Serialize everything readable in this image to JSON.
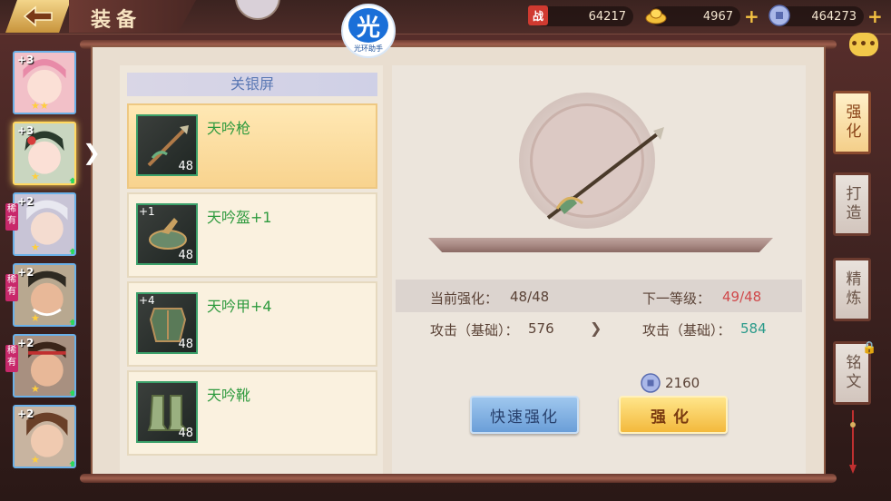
{
  "header": {
    "title": "装备",
    "assistant_badge": "光",
    "assistant_label": "光环助手"
  },
  "resources": [
    {
      "icon": "battle-power-icon",
      "icon_text": "战",
      "value": "64217",
      "has_plus": false
    },
    {
      "icon": "gold-ingot-icon",
      "value": "4967",
      "has_plus": true
    },
    {
      "icon": "silver-coin-icon",
      "value": "464273",
      "has_plus": true
    }
  ],
  "heroes": [
    {
      "level": "+3",
      "stars": "★★",
      "rare": false,
      "upgrade": false,
      "active": false
    },
    {
      "level": "+3",
      "stars": "★",
      "rare": false,
      "upgrade": true,
      "active": true
    },
    {
      "level": "+2",
      "stars": "★",
      "rare": true,
      "rare_label": "稀有",
      "upgrade": true,
      "active": false
    },
    {
      "level": "+2",
      "stars": "★",
      "rare": true,
      "rare_label": "稀有",
      "upgrade": true,
      "active": false
    },
    {
      "level": "+2",
      "stars": "★",
      "rare": true,
      "rare_label": "稀有",
      "upgrade": true,
      "active": false
    },
    {
      "level": "+2",
      "stars": "★",
      "rare": false,
      "upgrade": true,
      "active": false
    }
  ],
  "character_name": "关银屏",
  "equipment": [
    {
      "name": "天吟枪",
      "plus": "",
      "level": "48",
      "selected": true,
      "icon": "spear-icon"
    },
    {
      "name": "天吟盔+1",
      "plus": "+1",
      "level": "48",
      "selected": false,
      "icon": "helmet-icon"
    },
    {
      "name": "天吟甲+4",
      "plus": "+4",
      "level": "48",
      "selected": false,
      "icon": "armor-icon"
    },
    {
      "name": "天吟靴",
      "plus": "",
      "level": "48",
      "selected": false,
      "icon": "boots-icon"
    }
  ],
  "detail": {
    "current_label": "当前强化：",
    "current_value": "48/48",
    "next_label": "下一等级：",
    "next_value": "49/48",
    "attack_label": "攻击（基础）：",
    "attack_current": "576",
    "attack_next": "584",
    "cost": "2160"
  },
  "buttons": {
    "quick_enhance": "快速强化",
    "enhance": "强化"
  },
  "side_tabs": [
    {
      "label": "强化",
      "active": true,
      "locked": false
    },
    {
      "label": "打造",
      "active": false,
      "locked": false
    },
    {
      "label": "精炼",
      "active": false,
      "locked": false
    },
    {
      "label": "铭文",
      "active": false,
      "locked": true
    }
  ],
  "colors": {
    "accent_gold": "#f3b93c",
    "name_green": "#2e9a3e",
    "next_red": "#d0484a",
    "stat_teal": "#2a9a8a",
    "quick_blue": "#6a9ed8"
  }
}
